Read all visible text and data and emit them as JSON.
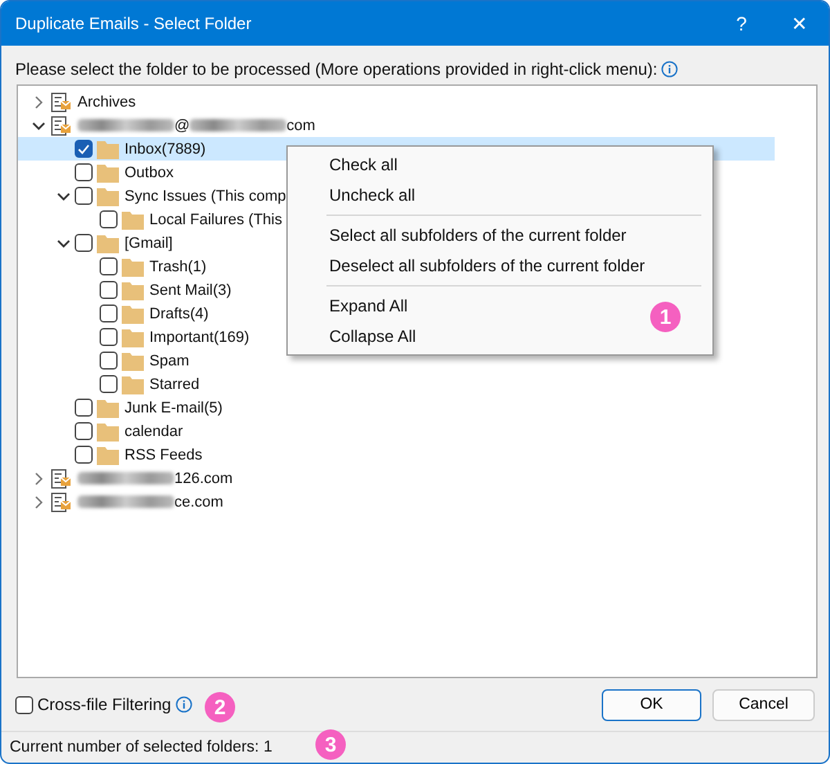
{
  "window": {
    "title": "Duplicate Emails - Select Folder",
    "help": "?",
    "close": "✕"
  },
  "instruction": "Please select the folder to be processed (More operations provided in right-click menu):",
  "tree": [
    {
      "kind": "account",
      "label": [
        {
          "kind": "text",
          "text": "Archives"
        }
      ],
      "expanded": false
    },
    {
      "kind": "account",
      "label": [
        {
          "kind": "redacted"
        },
        {
          "kind": "text",
          "text": "@"
        },
        {
          "kind": "redacted"
        },
        {
          "kind": "text",
          "text": "com"
        }
      ],
      "expanded": true,
      "children": [
        {
          "kind": "folder",
          "label": "Inbox(7889)",
          "checked": true,
          "selected": true
        },
        {
          "kind": "folder",
          "label": "Outbox",
          "checked": false,
          "selected": false
        },
        {
          "kind": "folder",
          "label": "Sync Issues (This comp",
          "checked": false,
          "selected": false,
          "expanded": true,
          "children": [
            {
              "kind": "folder",
              "label": "Local Failures (This",
              "checked": false,
              "selected": false
            }
          ]
        },
        {
          "kind": "folder",
          "label": "[Gmail]",
          "checked": false,
          "selected": false,
          "expanded": true,
          "children": [
            {
              "kind": "folder",
              "label": "Trash(1)",
              "checked": false,
              "selected": false
            },
            {
              "kind": "folder",
              "label": "Sent Mail(3)",
              "checked": false,
              "selected": false
            },
            {
              "kind": "folder",
              "label": "Drafts(4)",
              "checked": false,
              "selected": false
            },
            {
              "kind": "folder",
              "label": "Important(169)",
              "checked": false,
              "selected": false
            },
            {
              "kind": "folder",
              "label": "Spam",
              "checked": false,
              "selected": false
            },
            {
              "kind": "folder",
              "label": "Starred",
              "checked": false,
              "selected": false
            }
          ]
        },
        {
          "kind": "folder",
          "label": "Junk E-mail(5)",
          "checked": false,
          "selected": false
        },
        {
          "kind": "folder",
          "label": "calendar",
          "checked": false,
          "selected": false
        },
        {
          "kind": "folder",
          "label": "RSS Feeds",
          "checked": false,
          "selected": false
        }
      ]
    },
    {
      "kind": "account",
      "label": [
        {
          "kind": "redacted"
        },
        {
          "kind": "text",
          "text": "126.com"
        }
      ],
      "expanded": false
    },
    {
      "kind": "account",
      "label": [
        {
          "kind": "redacted"
        },
        {
          "kind": "text",
          "text": "ce.com"
        }
      ],
      "expanded": false
    }
  ],
  "context_menu": [
    [
      {
        "label": "Check all"
      },
      {
        "label": "Uncheck all"
      }
    ],
    [
      {
        "label": "Select all subfolders of the current folder"
      },
      {
        "label": "Deselect all subfolders of the current folder"
      }
    ],
    [
      {
        "label": "Expand All"
      },
      {
        "label": "Collapse All"
      }
    ]
  ],
  "cross_file_filtering": {
    "label": "Cross-file Filtering",
    "checked": false
  },
  "buttons": [
    {
      "label": "OK",
      "kind": "primary"
    },
    {
      "label": "Cancel",
      "kind": "normal"
    }
  ],
  "status_bar": "Current number of selected folders: 1",
  "callouts": [
    "1",
    "2",
    "3"
  ]
}
